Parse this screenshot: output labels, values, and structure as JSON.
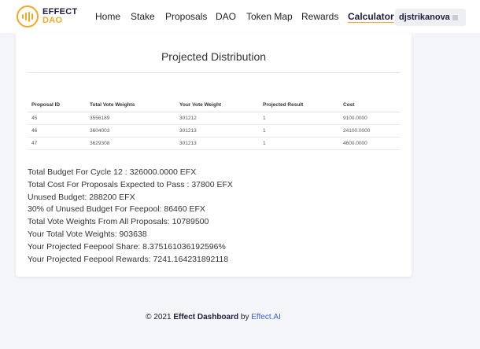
{
  "brand": {
    "name": "EFFECT",
    "sub": "DAO"
  },
  "nav": {
    "items": [
      "Home",
      "Stake",
      "Proposals",
      "DAO",
      "Token Map",
      "Rewards",
      "Calculator"
    ],
    "active": "Calculator",
    "user": "djstrikanova"
  },
  "colors": {
    "accent": "#f3a823",
    "brand_dark": "#1d1d3d",
    "link": "#3a5fd6"
  },
  "card": {
    "title": "Projected Distribution"
  },
  "table": {
    "headers": [
      "Proposal ID",
      "Total Vote Weights",
      "Your Vote Weight",
      "Projected Result",
      "Cost"
    ],
    "rows": [
      [
        "45",
        "3556189",
        "301212",
        "1",
        "9100.0000"
      ],
      [
        "46",
        "3604003",
        "301213",
        "1",
        "24100.0000"
      ],
      [
        "47",
        "3629308",
        "301213",
        "1",
        "4600.0000"
      ]
    ]
  },
  "summary": [
    "Total Budget For Cycle 12 : 326000.0000 EFX",
    "Total Cost For Proposals Expected to Pass : 37800 EFX",
    "Unused Budget: 288200 EFX",
    "30% of Unused Budget For Feepool: 86460 EFX",
    "Total Vote Weights From All Proposals: 10789500",
    "Your Total Vote Weights: 903638",
    "Your Projected Feepool Share: 8.375161036192596%",
    "Your Projected Feepool Rewards: 7241.164231892118"
  ],
  "footer": {
    "prefix": "© 2021",
    "name": "Effect Dashboard",
    "by": "by",
    "link": "Effect.AI"
  }
}
